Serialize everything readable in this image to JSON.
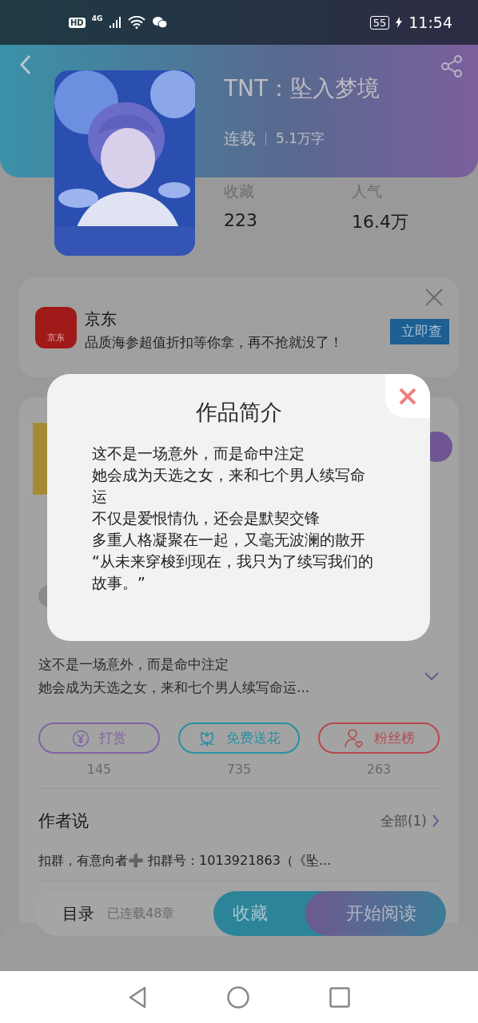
{
  "status_bar": {
    "hd": "HD",
    "network": "4G",
    "battery": "55",
    "time": "11:54"
  },
  "book": {
    "title": "TNT：坠入梦境",
    "status": "连载",
    "word_count": "5.1万字",
    "stats": [
      {
        "label": "收藏",
        "value": "223"
      },
      {
        "label": "人气",
        "value": "16.4万"
      }
    ]
  },
  "ad": {
    "icon_text": "京东",
    "name": "京东",
    "description": "品质海参超值折扣等你拿，再不抢就没了！",
    "button": "立即查"
  },
  "intro_preview": [
    "这不是一场意外，而是命中注定",
    "她会成为天选之女，来和七个男人续写命运..."
  ],
  "actions": [
    {
      "kind": "tip",
      "label": "打赏",
      "count": "145"
    },
    {
      "kind": "flower",
      "label": "免费送花",
      "count": "735"
    },
    {
      "kind": "fans",
      "label": "粉丝榜",
      "count": "263"
    }
  ],
  "author_note": {
    "title": "作者说",
    "more": "全部(1)",
    "text": "扣群，有意向者➕ 扣群号：1013921863（《坠..."
  },
  "bottom_bar": {
    "catalog": "目录",
    "chapters": "已连载48章",
    "collect": "收藏",
    "read": "开始阅读"
  },
  "dialog": {
    "title": "作品简介",
    "lines": [
      "这不是一场意外，而是命中注定",
      "她会成为天选之女，来和七个男人续写命运",
      "不仅是爱恨情仇，还会是默契交锋",
      "多重人格凝聚在一起，又毫无波澜的散开",
      "“从未来穿梭到现在，我只为了续写我们的故事。”"
    ]
  }
}
